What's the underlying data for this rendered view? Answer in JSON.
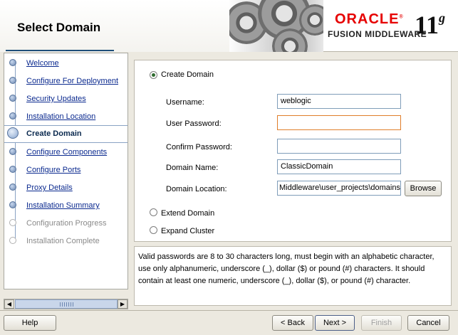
{
  "header": {
    "title": "Select Domain",
    "oracle_logo": "ORACLE",
    "fusion": "FUSION MIDDLEWARE",
    "version_main": "11",
    "version_suffix": "g"
  },
  "nav": {
    "items": [
      {
        "label": "Welcome",
        "state": "done"
      },
      {
        "label": "Configure For Deployment",
        "state": "done"
      },
      {
        "label": "Security Updates",
        "state": "done"
      },
      {
        "label": "Installation Location",
        "state": "done"
      },
      {
        "label": "Create Domain",
        "state": "current"
      },
      {
        "label": "Configure Components",
        "state": "done"
      },
      {
        "label": "Configure Ports",
        "state": "done"
      },
      {
        "label": "Proxy Details",
        "state": "done"
      },
      {
        "label": "Installation Summary",
        "state": "done"
      },
      {
        "label": "Configuration Progress",
        "state": "disabled"
      },
      {
        "label": "Installation Complete",
        "state": "disabled"
      }
    ]
  },
  "form": {
    "create_domain": "Create Domain",
    "extend_domain": "Extend Domain",
    "expand_cluster": "Expand Cluster",
    "selected_option": "Create Domain",
    "username_label": "Username:",
    "username_value": "weblogic",
    "user_password_label": "User Password:",
    "user_password_value": "",
    "confirm_password_label": "Confirm Password:",
    "confirm_password_value": "",
    "domain_name_label": "Domain Name:",
    "domain_name_value": "ClassicDomain",
    "domain_location_label": "Domain Location:",
    "domain_location_value": "Middleware\\user_projects\\domains",
    "browse_label": "Browse"
  },
  "info_text": "Valid passwords are 8 to 30 characters long, must begin with an alphabetic character, use only alphanumeric, underscore (_), dollar ($) or pound (#) characters. It should contain at least one numeric, underscore (_), dollar ($), or pound (#) character.",
  "buttons": {
    "help": "Help",
    "back": "< Back",
    "next": "Next >",
    "finish": "Finish",
    "cancel": "Cancel"
  },
  "colors": {
    "oracle_red": "#e60000",
    "link_blue": "#0b2a8f"
  }
}
